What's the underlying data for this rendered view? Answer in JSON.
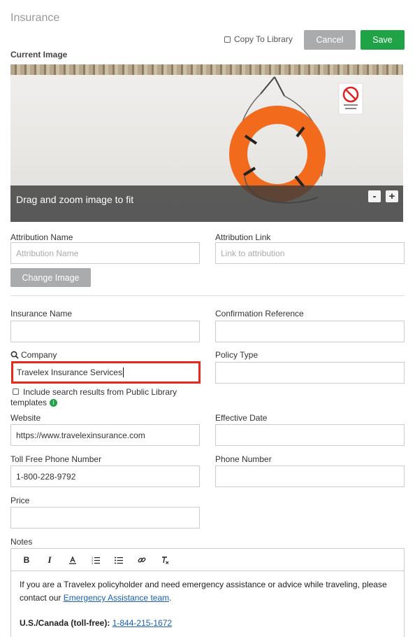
{
  "page": {
    "title": "Insurance"
  },
  "header": {
    "copy_to_library": "Copy To Library",
    "cancel": "Cancel",
    "save": "Save"
  },
  "image_section": {
    "label": "Current Image",
    "overlay_text": "Drag and zoom image to fit",
    "zoom_out": "-",
    "zoom_in": "+",
    "attribution_name_label": "Attribution Name",
    "attribution_name_placeholder": "Attribution Name",
    "attribution_link_label": "Attribution Link",
    "attribution_link_placeholder": "Link to attribution",
    "change_image": "Change Image"
  },
  "form": {
    "insurance_name_label": "Insurance Name",
    "insurance_name_value": "",
    "confirmation_reference_label": "Confirmation Reference",
    "confirmation_reference_value": "",
    "company_label": "Company",
    "company_value": "Travelex Insurance Services",
    "policy_type_label": "Policy Type",
    "policy_type_value": "",
    "include_public_line1": "Include search results from Public Library",
    "include_public_line2": "templates",
    "website_label": "Website",
    "website_value": "https://www.travelexinsurance.com",
    "effective_date_label": "Effective Date",
    "effective_date_value": "",
    "toll_free_label": "Toll Free Phone Number",
    "toll_free_value": "1-800-228-9792",
    "phone_label": "Phone Number",
    "phone_value": "",
    "price_label": "Price",
    "price_value": "",
    "notes_label": "Notes"
  },
  "notes": {
    "toolbar": [
      "bold-icon",
      "italic-icon",
      "font-color-icon",
      "ordered-list-icon",
      "bullet-list-icon",
      "link-icon",
      "clear-format-icon"
    ],
    "text_line1": "If you are a Travelex policyholder and need emergency assistance or advice while traveling, please",
    "text_line2_prefix": "contact our",
    "text_link": "Emergency Assistance team",
    "text_line2_suffix": ".",
    "phone_label": "U.S./Canada (toll-free):",
    "phone_link": "1-844-215-1672"
  },
  "colors": {
    "save": "#20a346",
    "cancel": "#a9abad",
    "highlight": "#e8291c",
    "link": "#1a5fb4",
    "life_ring": "#f26a1b"
  }
}
